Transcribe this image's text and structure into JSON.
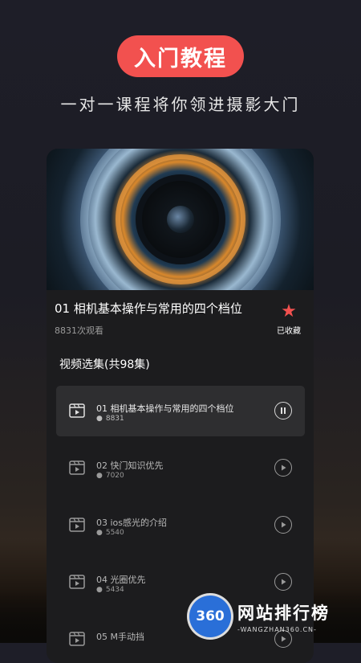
{
  "hero": {
    "badge": "入门教程",
    "subtitle": "一对一课程将你领进摄影大门"
  },
  "video": {
    "title": "01 相机基本操作与常用的四个档位",
    "views": "8831次观看",
    "favorite_label": "已收藏",
    "favorite_icon": "star-icon",
    "accent": "#f2514f"
  },
  "episodes": {
    "section_title": "视频选集(共98集)",
    "items": [
      {
        "title": "01 相机基本操作与常用的四个档位",
        "count": "8831",
        "state": "pause",
        "active": true
      },
      {
        "title": "02 快门知识优先",
        "count": "7020",
        "state": "play",
        "active": false
      },
      {
        "title": "03 ios感光的介绍",
        "count": "5540",
        "state": "play",
        "active": false
      },
      {
        "title": "04 光圈优先",
        "count": "5434",
        "state": "play",
        "active": false
      },
      {
        "title": "05 M手动挡",
        "count": "",
        "state": "play",
        "active": false
      }
    ]
  },
  "watermark": {
    "logo_text": "360",
    "title": "网站排行榜",
    "subtitle": "-WANGZHAN360.CN-"
  }
}
